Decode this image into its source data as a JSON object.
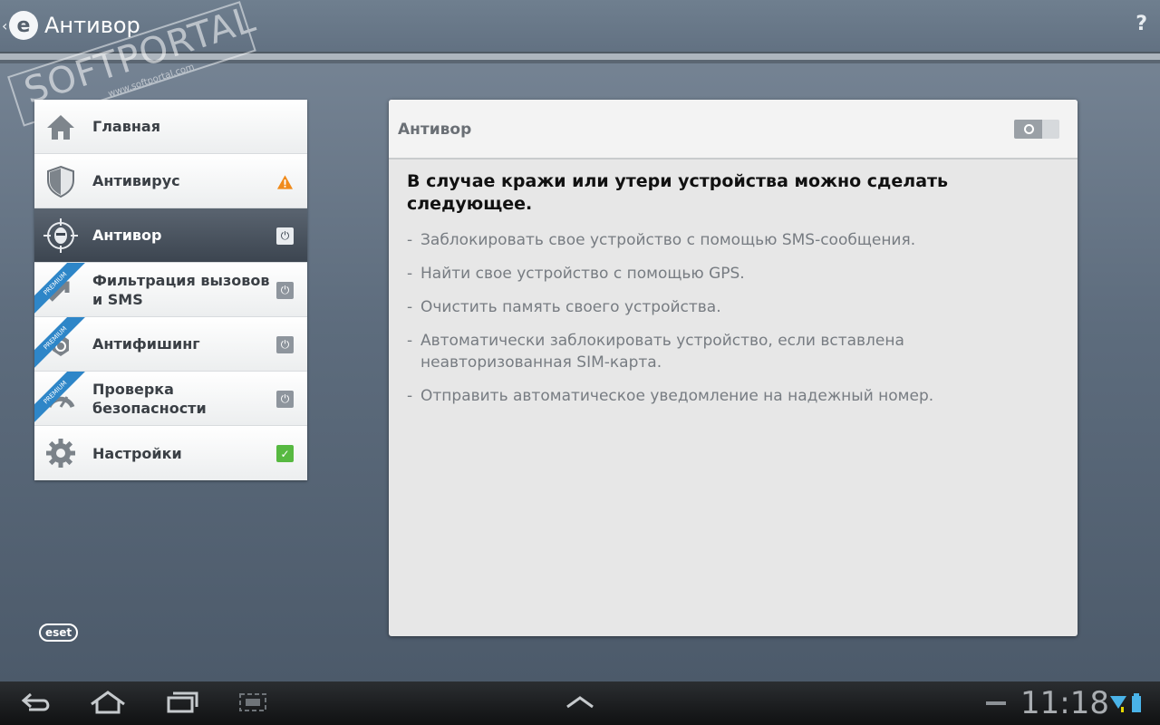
{
  "app": {
    "title": "Антивор",
    "logo_letter": "e",
    "help": "?"
  },
  "watermark": {
    "text": "SOFTPORTAL",
    "sub": "www.softportal.com",
    "tm": "™"
  },
  "nav": {
    "items": [
      {
        "label": "Главная",
        "icon": "home-icon",
        "status": "",
        "premium": false,
        "active": false
      },
      {
        "label": "Антивирус",
        "icon": "shield-icon",
        "status": "warning",
        "premium": false,
        "active": false
      },
      {
        "label": "Антивор",
        "icon": "antitheft-icon",
        "status": "power",
        "premium": false,
        "active": true
      },
      {
        "label": "Фильтрация вызовов и SMS",
        "icon": "call-filter-icon",
        "status": "power",
        "premium": true,
        "active": false
      },
      {
        "label": "Антифишинг",
        "icon": "antiphishing-icon",
        "status": "power",
        "premium": true,
        "active": false
      },
      {
        "label": "Проверка безопасности",
        "icon": "security-audit-icon",
        "status": "power",
        "premium": true,
        "active": false
      },
      {
        "label": "Настройки",
        "icon": "gear-icon",
        "status": "check",
        "premium": false,
        "active": false
      }
    ],
    "premium_label": "PREMIUM"
  },
  "eset_logo": "eset",
  "panel": {
    "title": "Антивор",
    "toggle_state": "off",
    "heading": "В случае кражи или утери устройства можно сделать следующее.",
    "bullets": [
      "Заблокировать свое устройство с помощью SMS-сообщения.",
      "Найти свое устройство с помощью GPS.",
      "Очистить память своего устройства.",
      "Автоматически заблокировать устройство, если вставлена неавторизованная SIM-карта.",
      "Отправить автоматическое уведомление на надежный номер."
    ]
  },
  "system_bar": {
    "clock": "11:18",
    "icons": [
      "back-icon",
      "home-icon",
      "recent-apps-icon",
      "screenshot-icon",
      "menu-up-icon",
      "minimize-icon",
      "wifi-icon",
      "battery-icon"
    ]
  },
  "colors": {
    "active_item": "#3c4550",
    "warning": "#f08a1a",
    "check": "#57b941",
    "premium": "#2e86c8"
  }
}
